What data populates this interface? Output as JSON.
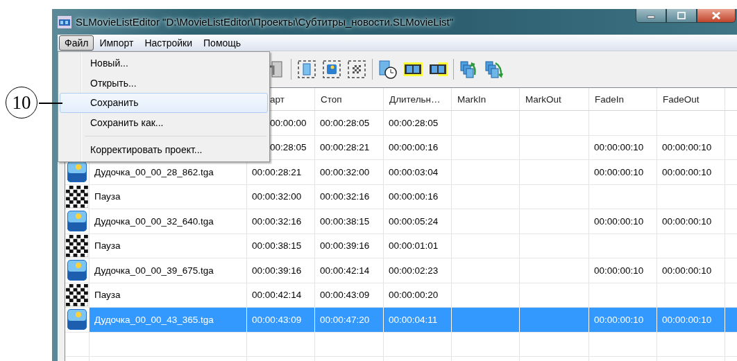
{
  "callout": {
    "label": "10"
  },
  "window": {
    "title": "SLMovieListEditor \"D:\\MovieListEditor\\Проекты\\Субтитры_новости.SLMovieList\""
  },
  "menu_bar": [
    {
      "label": "Файл",
      "selected": true
    },
    {
      "label": "Импорт",
      "selected": false
    },
    {
      "label": "Настройки",
      "selected": false
    },
    {
      "label": "Помощь",
      "selected": false
    }
  ],
  "file_menu": {
    "items": [
      {
        "kind": "item",
        "label": "Новый...",
        "highlighted": false
      },
      {
        "kind": "item",
        "label": "Открыть...",
        "highlighted": false
      },
      {
        "kind": "item",
        "label": "Сохранить",
        "highlighted": true
      },
      {
        "kind": "item",
        "label": "Сохранить как...",
        "highlighted": false
      },
      {
        "kind": "separator"
      },
      {
        "kind": "item",
        "label": "Корректировать проект...",
        "highlighted": false
      }
    ]
  },
  "table": {
    "columns": [
      {
        "label": "арт",
        "clipped": true
      },
      {
        "label": "Стоп",
        "clipped": false
      },
      {
        "label": "Длительн…",
        "clipped": false
      },
      {
        "label": "MarkIn",
        "clipped": false
      },
      {
        "label": "MarkOut",
        "clipped": false
      },
      {
        "label": "FadeIn",
        "clipped": false
      },
      {
        "label": "FadeOut",
        "clipped": false
      }
    ],
    "rows": [
      {
        "kind": "covered",
        "selected": false,
        "start": "00:00:00",
        "start_clipped": true,
        "stop": "00:00:28:05",
        "duration": "00:00:28:05"
      },
      {
        "kind": "covered",
        "selected": false,
        "start": "00:28:05",
        "start_clipped": true,
        "stop": "00:00:28:21",
        "duration": "00:00:00:16",
        "fade_in": "00:00:00:10",
        "fade_out": "00:00:00:10"
      },
      {
        "kind": "image",
        "selected": false,
        "name": "Дудочка_00_00_28_862.tga",
        "start": "00:00:28:21",
        "start_clipped": false,
        "stop": "00:00:32:00",
        "duration": "00:00:03:04",
        "fade_in": "00:00:00:10",
        "fade_out": "00:00:00:10"
      },
      {
        "kind": "pause",
        "selected": false,
        "name": "Пауза",
        "start": "00:00:32:00",
        "start_clipped": false,
        "stop": "00:00:32:16",
        "duration": "00:00:00:16"
      },
      {
        "kind": "image",
        "selected": false,
        "name": "Дудочка_00_00_32_640.tga",
        "start": "00:00:32:16",
        "start_clipped": false,
        "stop": "00:00:38:15",
        "duration": "00:00:05:24",
        "fade_in": "00:00:00:10",
        "fade_out": "00:00:00:10"
      },
      {
        "kind": "pause",
        "selected": false,
        "name": "Пауза",
        "start": "00:00:38:15",
        "start_clipped": false,
        "stop": "00:00:39:16",
        "duration": "00:00:01:01"
      },
      {
        "kind": "image",
        "selected": false,
        "name": "Дудочка_00_00_39_675.tga",
        "start": "00:00:39:16",
        "start_clipped": false,
        "stop": "00:00:42:14",
        "duration": "00:00:02:23",
        "fade_in": "00:00:00:10",
        "fade_out": "00:00:00:10"
      },
      {
        "kind": "pause",
        "selected": false,
        "name": "Пауза",
        "start": "00:00:42:14",
        "start_clipped": false,
        "stop": "00:00:43:09",
        "duration": "00:00:00:20"
      },
      {
        "kind": "image",
        "selected": true,
        "name": "Дудочка_00_00_43_365.tga",
        "start": "00:00:43:09",
        "start_clipped": false,
        "stop": "00:00:47:20",
        "duration": "00:00:04:11",
        "fade_in": "00:00:00:10",
        "fade_out": "00:00:00:10"
      }
    ]
  }
}
